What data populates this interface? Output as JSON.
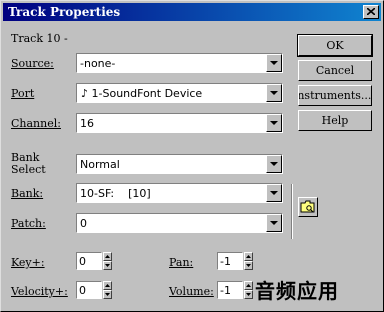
{
  "window": {
    "title": "Track Properties"
  },
  "track": {
    "label": "Track 10 -"
  },
  "fields": {
    "source": {
      "label": "Source:",
      "value": "-none-"
    },
    "port": {
      "label": "Port",
      "value": "1-SoundFont Device",
      "icon": "music-note-icon"
    },
    "channel": {
      "label": "Channel:",
      "value": "16"
    },
    "bank_select": {
      "label_line1": "Bank",
      "label_line2": "Select",
      "value": "Normal"
    },
    "bank": {
      "label": "Bank:",
      "value": "10-SF:    [10]"
    },
    "patch": {
      "label": "Patch:",
      "value": "0"
    }
  },
  "spinners": {
    "key": {
      "label": "Key+:",
      "value": "0"
    },
    "velocity": {
      "label": "Velocity+:",
      "value": "0"
    },
    "pan": {
      "label": "Pan:",
      "value": "-1"
    },
    "volume": {
      "label": "Volume:",
      "value": "-1"
    }
  },
  "buttons": {
    "ok": "OK",
    "cancel": "Cancel",
    "instruments": "Instruments...",
    "help": "Help"
  },
  "watermark": "音频应用"
}
